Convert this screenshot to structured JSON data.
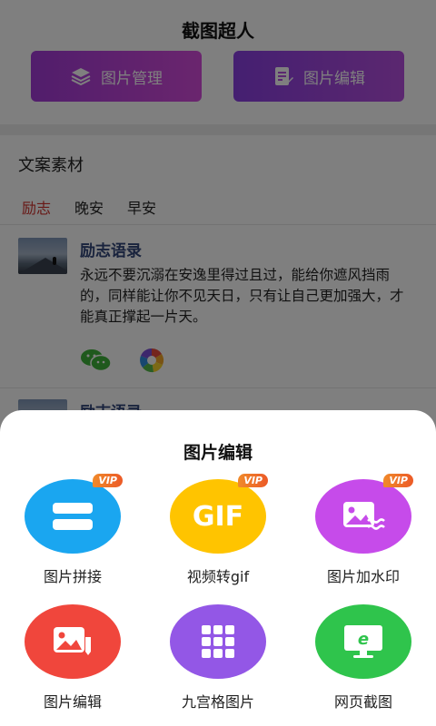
{
  "header": {
    "title": "截图超人"
  },
  "top_buttons": [
    {
      "label": "图片管理",
      "icon": "layers-icon"
    },
    {
      "label": "图片编辑",
      "icon": "edit-doc-icon"
    }
  ],
  "section": {
    "title": "文案素材"
  },
  "tabs": [
    {
      "label": "励志",
      "active": true
    },
    {
      "label": "晚安",
      "active": false
    },
    {
      "label": "早安",
      "active": false
    }
  ],
  "posts": [
    {
      "title": "励志语录",
      "body": "永远不要沉溺在安逸里得过且过，能给你遮风挡雨的，同样能让你不见天日，只有让自己更加强大，才能真正撑起一片天。",
      "share": [
        "wechat-icon",
        "moments-icon"
      ]
    },
    {
      "title": "励志语录"
    }
  ],
  "sheet": {
    "title": "图片编辑",
    "badge_text": "VIP",
    "tools": [
      {
        "label": "图片拼接",
        "icon": "stitch-icon",
        "vip": true,
        "color": "#1aa6f0"
      },
      {
        "label": "视频转gif",
        "icon_text": "GIF",
        "vip": true,
        "color": "#ffc400"
      },
      {
        "label": "图片加水印",
        "icon": "watermark-icon",
        "vip": true,
        "color": "#c64bea"
      },
      {
        "label": "图片编辑",
        "icon": "image-edit-icon",
        "vip": false,
        "color": "#f0463c"
      },
      {
        "label": "九宫格图片",
        "icon": "grid-icon",
        "vip": false,
        "color": "#9357e6"
      },
      {
        "label": "网页截图",
        "icon": "web-capture-icon",
        "vip": false,
        "color": "#2fc44c"
      }
    ]
  }
}
